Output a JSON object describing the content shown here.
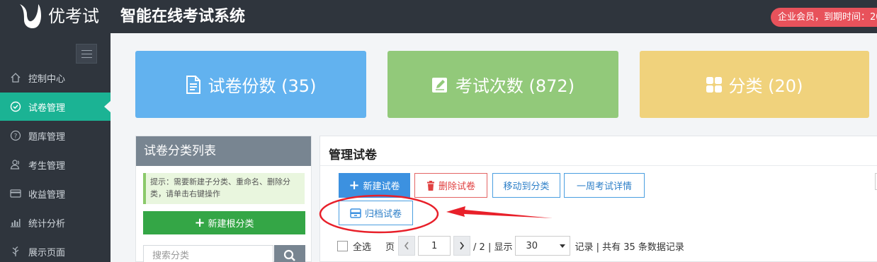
{
  "header": {
    "brand": "优考试",
    "system_title": "智能在线考试系统",
    "member_badge": "企业会员，到期时间：20"
  },
  "sidebar": {
    "items": [
      {
        "label": "控制中心",
        "icon": "home-icon"
      },
      {
        "label": "试卷管理",
        "icon": "check-circle-icon",
        "active": true
      },
      {
        "label": "题库管理",
        "icon": "question-circle-icon"
      },
      {
        "label": "考生管理",
        "icon": "users-icon"
      },
      {
        "label": "收益管理",
        "icon": "credit-card-icon"
      },
      {
        "label": "统计分析",
        "icon": "bar-chart-icon"
      },
      {
        "label": "展示页面",
        "icon": "leaf-icon"
      }
    ]
  },
  "stats": {
    "papers": "试卷份数 (35)",
    "exams": "考试次数 (872)",
    "categories": "分类 (20)"
  },
  "category_panel": {
    "title": "试卷分类列表",
    "tip": "提示：需要新建子分类、重命名、删除分类，请单击右键操作",
    "new_root_label": "新建根分类",
    "search_placeholder": "搜索分类"
  },
  "manage_panel": {
    "title": "管理试卷",
    "buttons": {
      "new": "新建试卷",
      "delete": "删除试卷",
      "move": "移动到分类",
      "week": "一周考试详情",
      "archive": "归档试卷"
    },
    "pager": {
      "select_all": "全选",
      "page_label": "页",
      "current_page": "1",
      "total_pages": "/ 2 | 显示",
      "page_size": "30",
      "records_text": "记录 | 共有 35 条数据记录"
    }
  },
  "colors": {
    "topbar": "#2f353d",
    "active_nav": "#1bb394",
    "card_blue": "#62b2ef",
    "card_green": "#92c97a",
    "card_yellow": "#f0d27c",
    "primary": "#3c91e0",
    "danger": "#e04040",
    "annotation": "#e8202a"
  }
}
